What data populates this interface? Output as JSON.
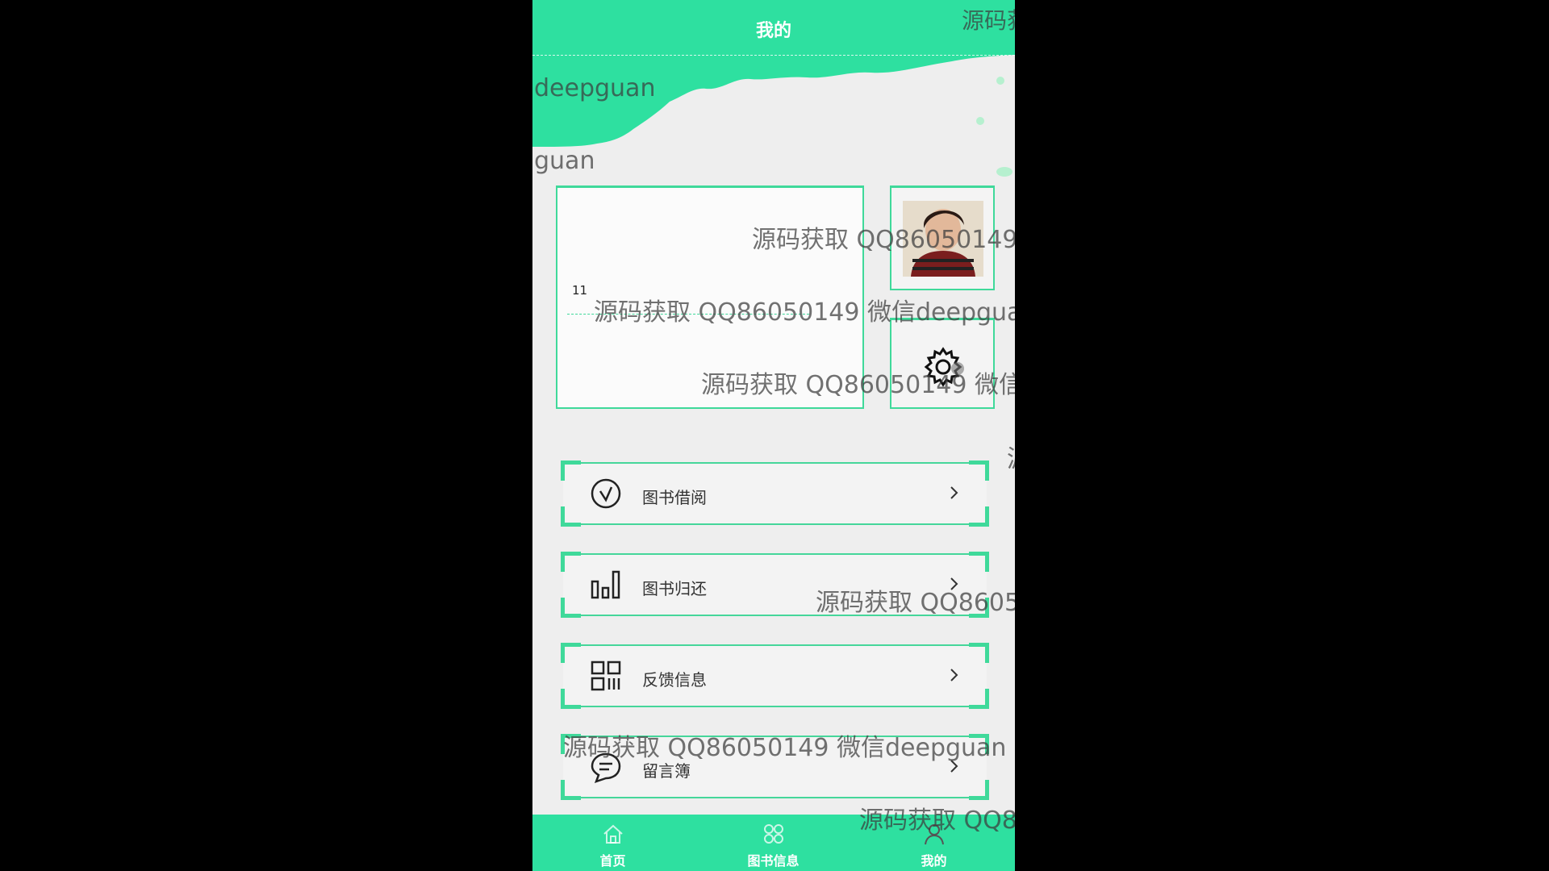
{
  "header": {
    "title": "我的"
  },
  "info_card": {
    "number": "11"
  },
  "menu": [
    {
      "label": "图书借阅",
      "icon": "clock-icon"
    },
    {
      "label": "图书归还",
      "icon": "bar-chart-icon"
    },
    {
      "label": "反馈信息",
      "icon": "grid-icon"
    },
    {
      "label": "留言簿",
      "icon": "chat-bubble-icon"
    }
  ],
  "tabbar": [
    {
      "label": "首页",
      "icon": "home-icon"
    },
    {
      "label": "图书信息",
      "icon": "apps-icon"
    },
    {
      "label": "我的",
      "icon": "user-icon"
    }
  ],
  "watermarks": {
    "top_right": "源码获",
    "deepguan": "deepguan",
    "guan": "guan",
    "card_1": "源码获取 QQ86050149",
    "card_2": "源码获取 QQ86050149 微信deepguan",
    "card_3": "源码获取 QQ86050149 微信",
    "edge": "源",
    "menu_2": "源码获取 QQ8605",
    "menu_4": "源码获取 QQ86050149 微信deepguan",
    "bottom": "源码获取 QQ8"
  },
  "colors": {
    "accent": "#2ee0a0",
    "border": "#3fd99a",
    "background": "#eeeeee"
  }
}
